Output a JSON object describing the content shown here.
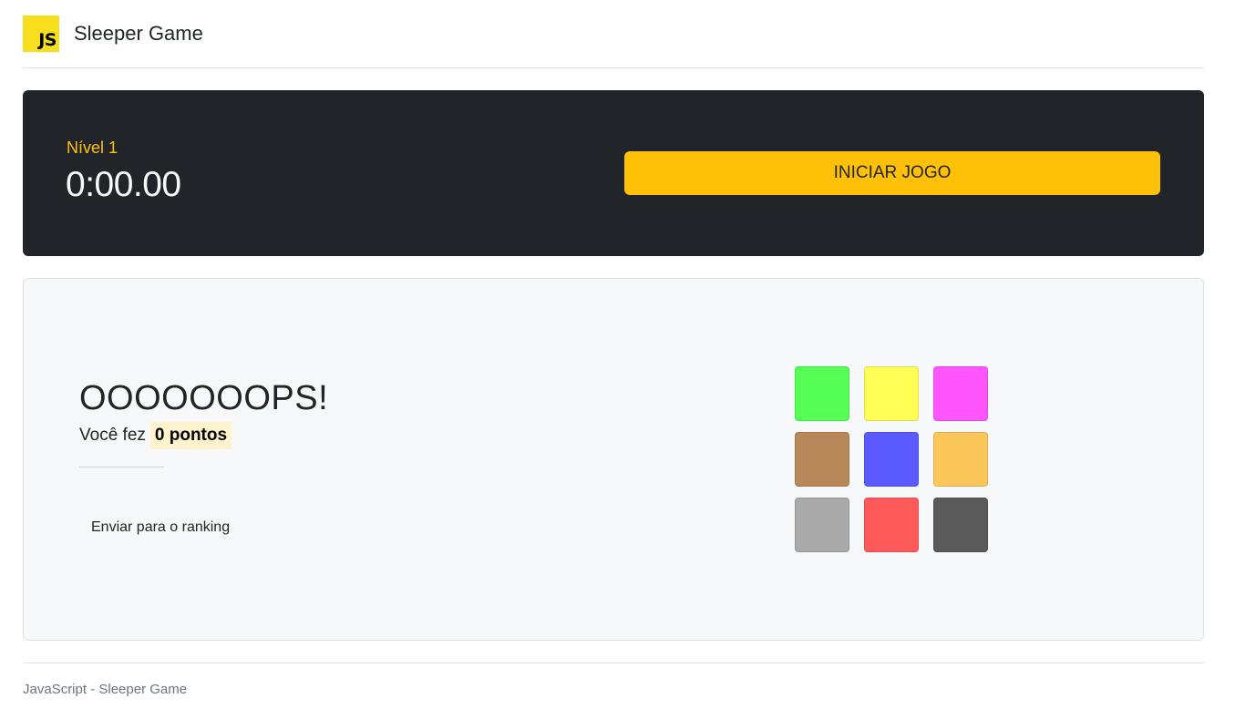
{
  "header": {
    "logo_text": "JS",
    "title": "Sleeper Game"
  },
  "status": {
    "level": "Nível 1",
    "timer": "0:00.00",
    "start_button": "INICIAR JOGO"
  },
  "result": {
    "title": "OOOOOOOPS!",
    "score_prefix": "Você fez",
    "score_value": "0 pontos",
    "ranking_button": "Enviar para o ranking"
  },
  "tiles": [
    {
      "name": "tile-green",
      "color": "#55ff55"
    },
    {
      "name": "tile-yellow",
      "color": "#ffff55"
    },
    {
      "name": "tile-magenta",
      "color": "#ff55ff"
    },
    {
      "name": "tile-brown",
      "color": "#b8875a"
    },
    {
      "name": "tile-blue",
      "color": "#5a5aff"
    },
    {
      "name": "tile-orange",
      "color": "#fcc75a"
    },
    {
      "name": "tile-gray",
      "color": "#aaaaaa"
    },
    {
      "name": "tile-red",
      "color": "#ff5a5a"
    },
    {
      "name": "tile-dark-gray",
      "color": "#5a5a5a"
    }
  ],
  "footer": {
    "text": "JavaScript - Sleeper Game"
  },
  "colors": {
    "accent": "#ffc107",
    "dark_panel": "#212529",
    "logo": "#f7df1e"
  }
}
